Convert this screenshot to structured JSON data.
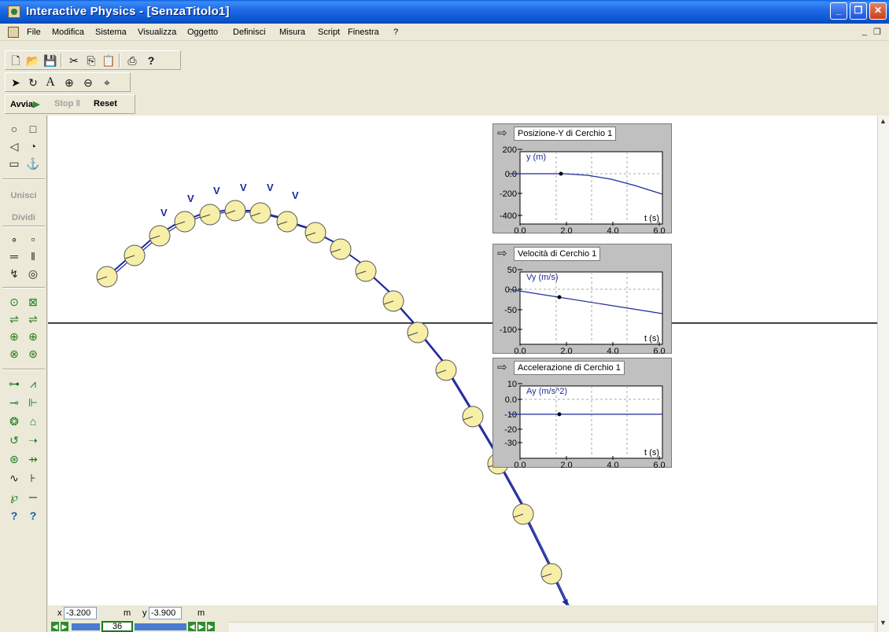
{
  "window": {
    "title": "Interactive Physics - [SenzaTitolo1]",
    "minimize_glyph": "_",
    "maximize_glyph": "❐",
    "close_glyph": "✕"
  },
  "menubar": {
    "items": [
      "File",
      "Modifica",
      "Sistema",
      "Visualizza",
      "Oggetto",
      "Definisci",
      "Misura",
      "Script",
      "Finestra",
      "?"
    ],
    "mdi_minimize": "_",
    "mdi_restore": "❐"
  },
  "toolbar_file": {
    "icons": [
      "new-icon",
      "open-icon",
      "save-icon",
      "cut-icon",
      "copy-icon",
      "paste-icon",
      "print-icon",
      "help-icon"
    ],
    "glyphs": [
      "🗋",
      "📂",
      "💾",
      "✂",
      "⎘",
      "📋",
      "⎙",
      "?"
    ]
  },
  "toolbar_tools": {
    "glyphs": [
      "➤",
      "↻",
      "A",
      "⊕",
      "⊖",
      "⌖"
    ]
  },
  "run_controls": {
    "run_label": "Avvia",
    "stop_label": "Stop",
    "reset_label": "Reset"
  },
  "palette": {
    "join_label": "Unisci",
    "split_label": "Dividi",
    "glyphs": [
      "○",
      "□",
      "◁",
      "◔",
      "▭",
      "⚓",
      "∘",
      "▫",
      "═",
      "‖",
      "↯",
      "◎",
      "⊙",
      "⊠",
      "⇌",
      "⇌",
      "⊕",
      "⊕",
      "⊗",
      "⊛",
      "⊶",
      "⩘",
      "⊸",
      "⊩",
      "❂",
      "⌂",
      "↺",
      "➝",
      "⊛",
      "⇸",
      "∿",
      "⊦",
      "℘",
      "─",
      "?",
      "?"
    ]
  },
  "meters": [
    {
      "title": "Posizione-Y di Cerchio 1",
      "series_label": "y (m)",
      "x_axis_label": "t (s)",
      "y_ticks": [
        "200",
        "0.0",
        "-200",
        "-400"
      ],
      "x_ticks": [
        "0.0",
        "2.0",
        "4.0",
        "6.0"
      ]
    },
    {
      "title": "Velocità di Cerchio 1",
      "series_label": "Vy (m/s)",
      "x_axis_label": "t (s)",
      "y_ticks": [
        "50",
        "0.0",
        "-50",
        "-100"
      ],
      "x_ticks": [
        "0.0",
        "2.0",
        "4.0",
        "6.0"
      ]
    },
    {
      "title": "Accelerazione di Cerchio 1",
      "series_label": "Ay (m/s^2)",
      "x_axis_label": "t (s)",
      "y_ticks": [
        "10",
        "0.0",
        "-10",
        "-20",
        "-30"
      ],
      "x_ticks": [
        "0.0",
        "2.0",
        "4.0",
        "6.0"
      ]
    }
  ],
  "velocity_label": "V",
  "coords": {
    "x_label": "x",
    "x_value": "-3.200",
    "x_unit": "m",
    "y_label": "y",
    "y_value": "-3.900",
    "y_unit": "m"
  },
  "frame": {
    "current": "36"
  },
  "colors": {
    "circle_fill": "#F7EEA8",
    "vector": "#1F2A9C",
    "titlebar": "#0A56D0"
  }
}
